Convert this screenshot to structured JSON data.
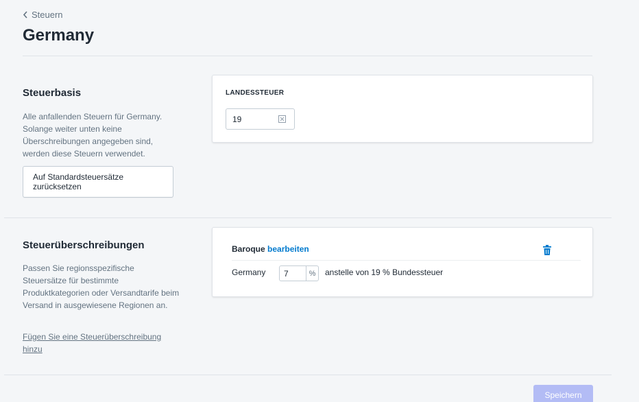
{
  "breadcrumb": {
    "label": "Steuern"
  },
  "page": {
    "title": "Germany"
  },
  "base_section": {
    "title": "Steuerbasis",
    "description": "Alle anfallenden Steuern für Germany. Solange weiter unten keine Überschreibungen angegeben sind, werden diese Steuern verwendet.",
    "reset_button": "Auf Standardsteuersätze zurücksetzen",
    "card": {
      "label": "LANDESSTEUER",
      "value": "19"
    }
  },
  "override_section": {
    "title": "Steuerüberschreibungen",
    "description": "Passen Sie regionsspezifische Steuersätze für bestimmte Produktkategorien oder Versandtarife beim Versand in ausgewiesene Regionen an.",
    "add_link": "Fügen Sie eine Steuerüberschreibung hinzu",
    "card": {
      "name": "Baroque",
      "edit_label": "bearbeiten",
      "row": {
        "region": "Germany",
        "rate": "7",
        "suffix": "%",
        "instead_text": "anstelle von 19 % Bundessteuer"
      }
    }
  },
  "footer": {
    "save_button": "Speichern"
  },
  "colors": {
    "link": "#007ace",
    "primary_disabled": "#b3bcf5",
    "background": "#f4f6f8"
  },
  "icons": {
    "back": "chevron-left-icon",
    "clear": "clear-icon",
    "delete": "trash-icon"
  }
}
